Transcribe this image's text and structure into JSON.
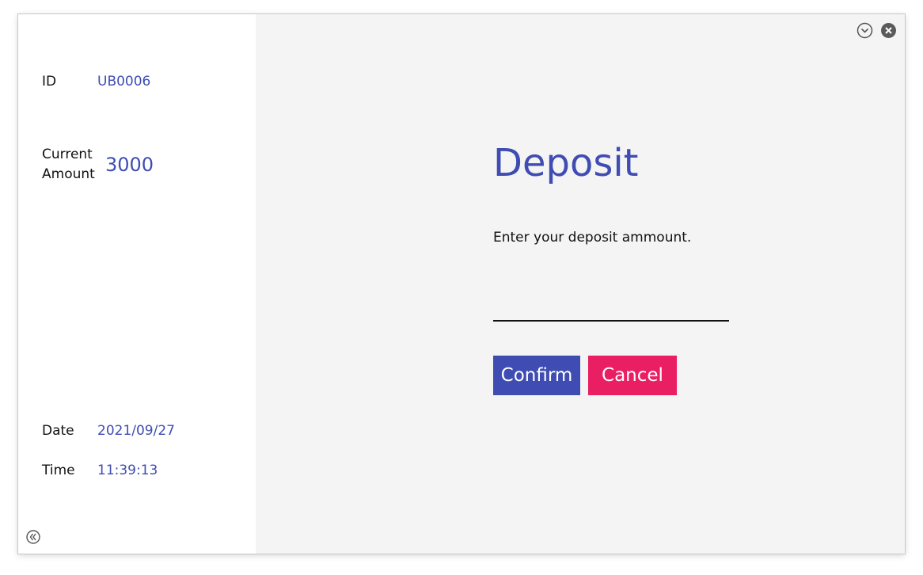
{
  "sidebar": {
    "id_label": "ID",
    "id_value": "UB0006",
    "amount_label": "Current Amount",
    "amount_value": "3000",
    "date_label": "Date",
    "date_value": "2021/09/27",
    "time_label": "Time",
    "time_value": "11:39:13",
    "collapse_icon": "chevron-left-circle-icon"
  },
  "window_controls": {
    "minimize_icon": "chevron-down-circle-icon",
    "close_icon": "close-circle-icon"
  },
  "deposit": {
    "title": "Deposit",
    "prompt": "Enter your deposit ammount.",
    "input_value": "",
    "confirm_label": "Confirm",
    "cancel_label": "Cancel"
  },
  "colors": {
    "accent": "#3f4db3",
    "cancel": "#e91e63",
    "panel_bg": "#f4f4f4",
    "sidebar_bg": "#ffffff"
  }
}
